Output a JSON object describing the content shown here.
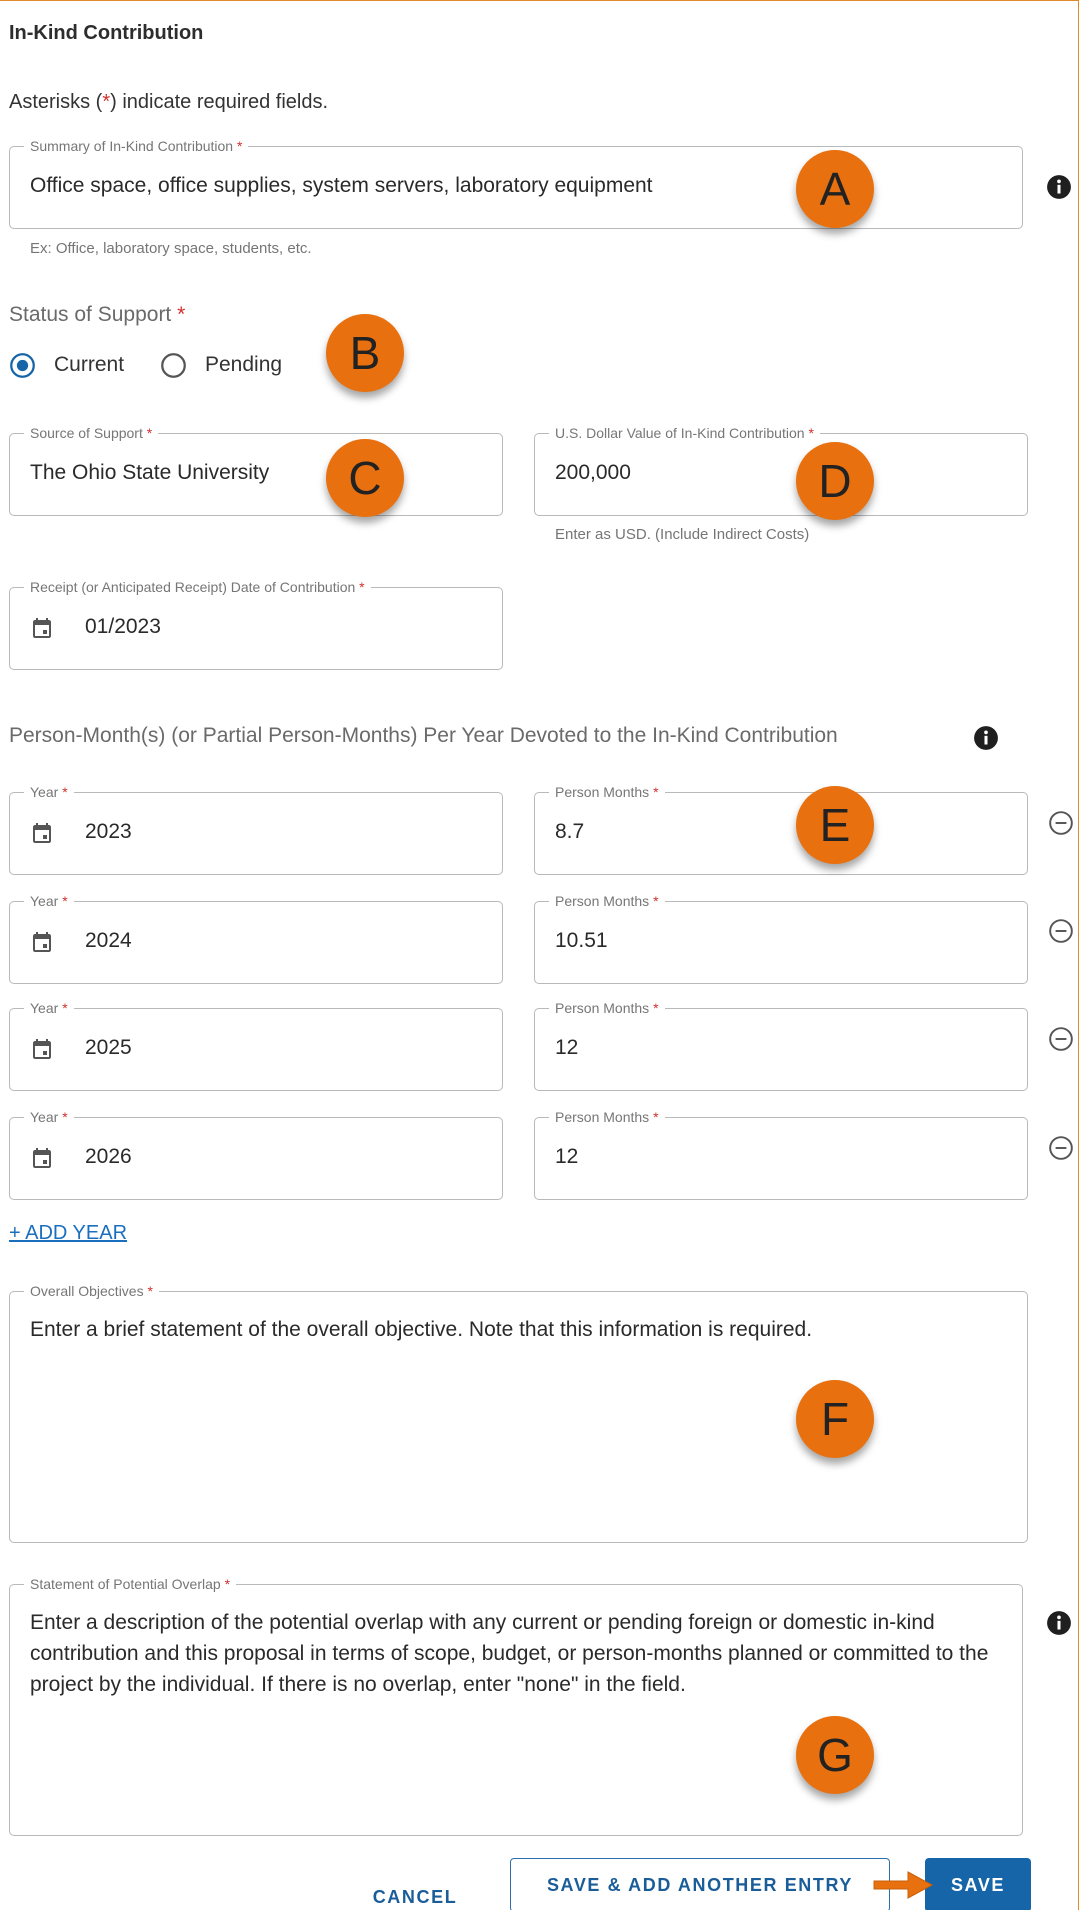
{
  "section_title": "In-Kind Contribution",
  "required_note": {
    "before": "Asterisks (",
    "star": "*",
    "after": ") indicate required fields."
  },
  "summary": {
    "label": "Summary of In-Kind Contribution",
    "value": "Office space, office supplies, system servers, laboratory equipment",
    "helper": "Ex: Office, laboratory space, students, etc."
  },
  "status": {
    "label": "Status of Support",
    "options": [
      "Current",
      "Pending"
    ],
    "selected": "Current"
  },
  "source": {
    "label": "Source of Support",
    "value": "The Ohio State University"
  },
  "dollar": {
    "label": "U.S. Dollar Value of In-Kind Contribution",
    "value": "200,000",
    "helper": "Enter as USD. (Include Indirect Costs)"
  },
  "receipt": {
    "label": "Receipt (or Anticipated Receipt) Date of Contribution",
    "value": "01/2023"
  },
  "person_months": {
    "heading": "Person-Month(s) (or Partial Person-Months) Per Year Devoted to the In-Kind Contribution",
    "year_label": "Year",
    "months_label": "Person Months",
    "rows": [
      {
        "year": "2023",
        "months": "8.7"
      },
      {
        "year": "2024",
        "months": "10.51"
      },
      {
        "year": "2025",
        "months": "12"
      },
      {
        "year": "2026",
        "months": "12"
      }
    ],
    "add_label": "+ ADD YEAR"
  },
  "objectives": {
    "label": "Overall Objectives",
    "value": "Enter a brief statement of the overall objective. Note that this information is required."
  },
  "overlap": {
    "label": "Statement of Potential Overlap",
    "value": "Enter a description of the potential overlap with any current or pending foreign or domestic in-kind contribution and this proposal in terms of scope, budget, or person-months planned or committed to the project by the individual. If there is no overlap, enter \"none\" in the field."
  },
  "star": "*",
  "buttons": {
    "cancel": "CANCEL",
    "save_another": "SAVE & ADD ANOTHER ENTRY",
    "save": "SAVE"
  },
  "callouts": [
    "A",
    "B",
    "C",
    "D",
    "E",
    "F",
    "G"
  ],
  "colors": {
    "accent": "#1565a8",
    "callout": "#e8700f",
    "required": "#d32f2f",
    "frame": "#e08a2e"
  }
}
